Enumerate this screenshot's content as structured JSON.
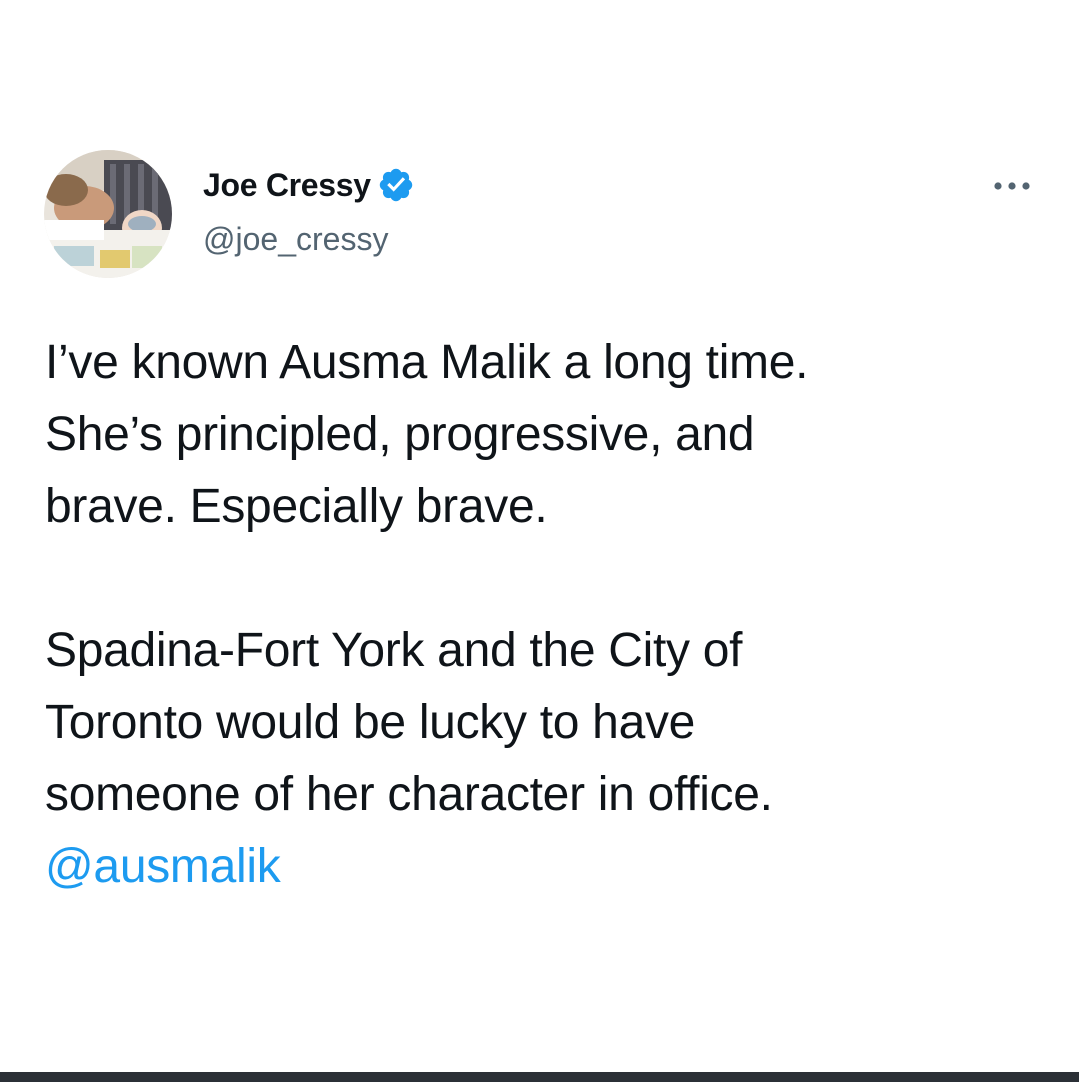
{
  "tweet": {
    "author": {
      "display_name": "Joe Cressy",
      "handle": "@joe_cressy",
      "verified": true,
      "verified_color": "#1d9bf0",
      "avatar_icon": "profile-photo"
    },
    "more_icon": "ellipsis-horizontal-icon",
    "body": {
      "line1": "I’ve known Ausma Malik a long time.",
      "line2": "She’s principled, progressive, and",
      "line3": "brave. Especially brave.",
      "line4": "Spadina-Fort York and the City of",
      "line5": "Toronto would be lucky to have",
      "line6": "someone of her character in office.",
      "mention": "@ausmalik"
    }
  },
  "colors": {
    "text": "#0f1419",
    "secondary": "#536471",
    "link": "#1d9bf0",
    "background": "#ffffff",
    "bottom_bar": "#2b3036"
  }
}
